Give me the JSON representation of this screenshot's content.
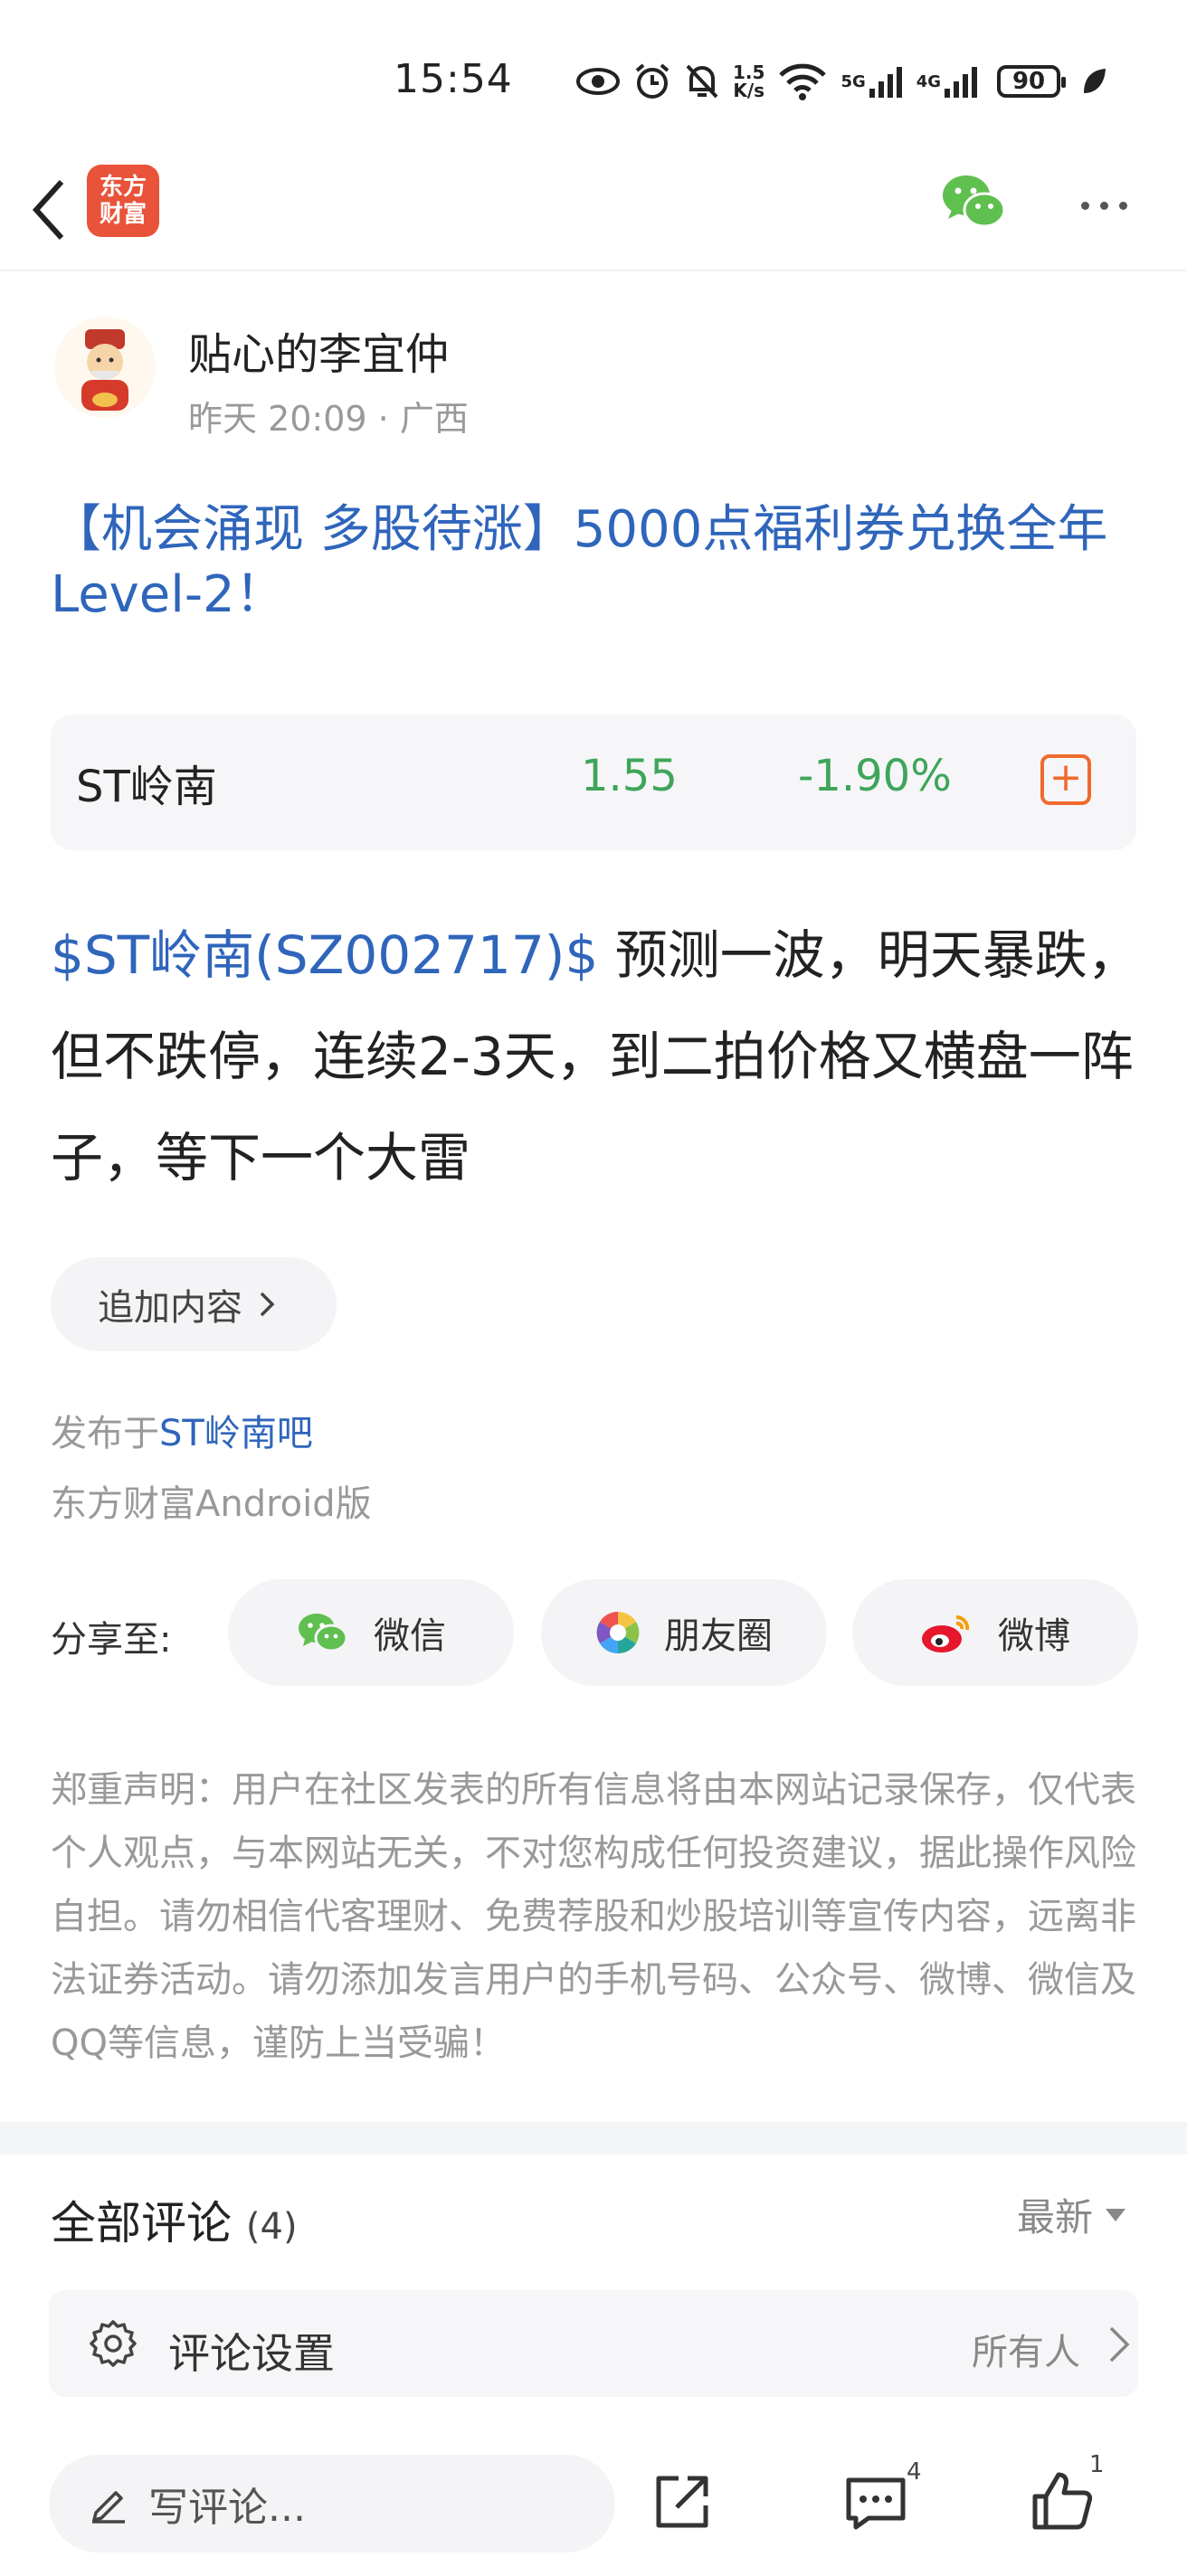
{
  "status_bar": {
    "time": "15:54",
    "net_speed_value": "1.5",
    "net_speed_unit": "K/s",
    "signal_1": "5G",
    "signal_2": "4G",
    "battery": "90",
    "icons": [
      "eye-icon",
      "alarm-icon",
      "mute-icon",
      "wifi-icon",
      "signal-icon",
      "battery-icon",
      "leaf-icon"
    ]
  },
  "nav": {
    "logo_line1": "东方",
    "logo_line2": "财富",
    "icons": [
      "back-icon",
      "wechat-icon",
      "more-icon"
    ]
  },
  "post": {
    "author": "贴心的李宜仲",
    "meta": "昨天 20:09 · 广西",
    "title": "【机会涌现 多股待涨】5000点福利券兑换全年Level-2！",
    "stock": {
      "name": "ST岭南",
      "price": "1.55",
      "change": "-1.90%",
      "add_symbol": "+"
    },
    "body_link": "$ST岭南(SZ002717)$",
    "body_text": "  预测一波，明天暴跌，但不跌停，连续2-3天，到二拍价格又横盘一阵子，等下一个大雷",
    "append_label": "追加内容",
    "published_prefix": "发布于",
    "published_bar": "ST岭南吧",
    "client": "东方财富Android版"
  },
  "share": {
    "label": "分享至:",
    "wechat": "微信",
    "moments": "朋友圈",
    "weibo": "微博"
  },
  "disclaimer": "郑重声明：用户在社区发表的所有信息将由本网站记录保存，仅代表个人观点，与本网站无关，不对您构成任何投资建议，据此操作风险自担。请勿相信代客理财、免费荐股和炒股培训等宣传内容，远离非法证券活动。请勿添加发言用户的手机号码、公众号、微博、微信及QQ等信息，谨防上当受骗！",
  "comments": {
    "title": "全部评论",
    "count": "(4)",
    "sort": "最新",
    "settings_label": "评论设置",
    "settings_value": "所有人"
  },
  "bottom_bar": {
    "placeholder": "写评论...",
    "comment_count": "4",
    "like_count": "1"
  },
  "colors": {
    "link_blue": "#2f65bb",
    "stock_green": "#3ea55a",
    "brand_orange": "#e8533a",
    "wechat_green": "#5fbf4f"
  }
}
